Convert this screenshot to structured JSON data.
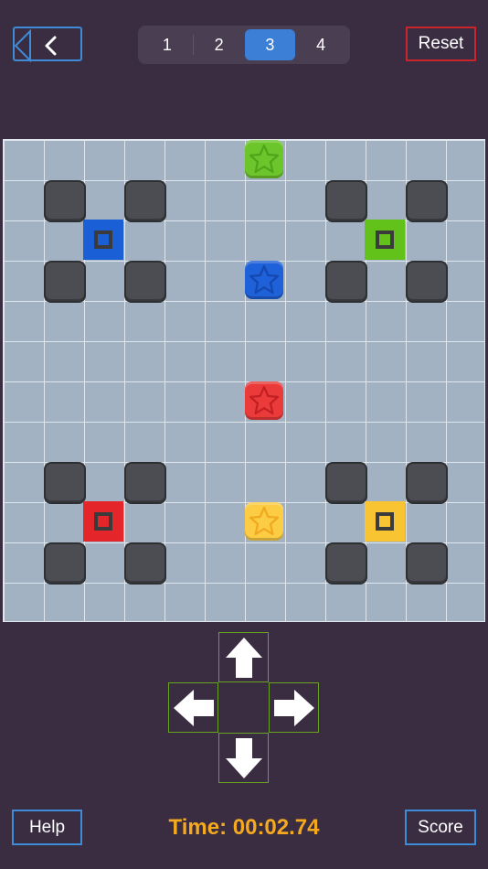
{
  "header": {
    "back_icon": "chevron-left-icon",
    "levels": [
      {
        "label": "1",
        "active": false
      },
      {
        "label": "2",
        "active": false
      },
      {
        "label": "3",
        "active": true
      },
      {
        "label": "4",
        "active": false
      }
    ],
    "reset_label": "Reset"
  },
  "board": {
    "grid_size": 12,
    "walls": [
      [
        1,
        1
      ],
      [
        3,
        1
      ],
      [
        8,
        1
      ],
      [
        10,
        1
      ],
      [
        1,
        3
      ],
      [
        3,
        3
      ],
      [
        8,
        3
      ],
      [
        10,
        3
      ],
      [
        1,
        8
      ],
      [
        3,
        8
      ],
      [
        8,
        8
      ],
      [
        10,
        8
      ],
      [
        1,
        10
      ],
      [
        3,
        10
      ],
      [
        8,
        10
      ],
      [
        10,
        10
      ]
    ],
    "targets": [
      {
        "color": "blue",
        "hex": "#1a5fd6",
        "col": 2,
        "row": 2
      },
      {
        "color": "green",
        "hex": "#62c21a",
        "col": 9,
        "row": 2
      },
      {
        "color": "red",
        "hex": "#e4262a",
        "col": 2,
        "row": 9
      },
      {
        "color": "yellow",
        "hex": "#f9c431",
        "col": 9,
        "row": 9
      }
    ],
    "pieces": [
      {
        "color": "green",
        "hex": "#6cc52a",
        "star": "#4ea51a",
        "col": 6,
        "row": 0,
        "icon": "star-icon"
      },
      {
        "color": "blue",
        "hex": "#1e61d8",
        "star": "#1448b0",
        "col": 6,
        "row": 3,
        "icon": "star-icon"
      },
      {
        "color": "red",
        "hex": "#ea3a3a",
        "star": "#c21f22",
        "col": 6,
        "row": 6,
        "icon": "star-icon"
      },
      {
        "color": "yellow",
        "hex": "#fbcc44",
        "star": "#f0a91e",
        "col": 6,
        "row": 9,
        "icon": "star-icon"
      }
    ]
  },
  "controls": {
    "up_icon": "arrow-up-icon",
    "left_icon": "arrow-left-icon",
    "right_icon": "arrow-right-icon",
    "down_icon": "arrow-down-icon"
  },
  "footer": {
    "help_label": "Help",
    "timer_text": "Time: 00:02.74",
    "score_label": "Score"
  }
}
